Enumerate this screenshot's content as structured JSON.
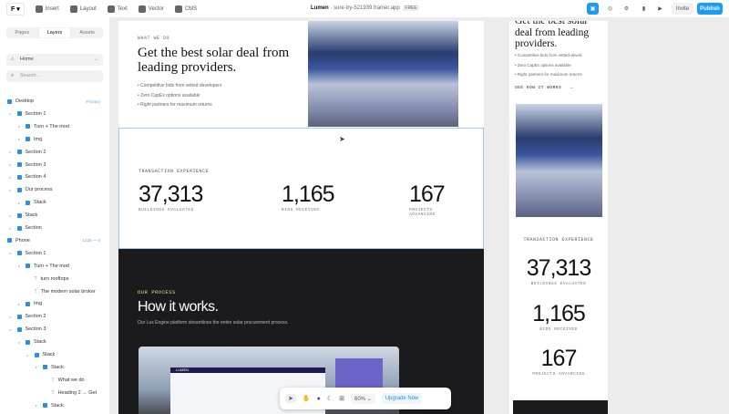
{
  "topbar": {
    "logo": "F",
    "menu": [
      "Insert",
      "Layout",
      "Text",
      "Vector",
      "CMS"
    ],
    "project": "Lumen",
    "domain": "sure-try-521939.framer.app",
    "plan": "FREE",
    "invite": "Invite",
    "publish": "Publish"
  },
  "left": {
    "tabs": [
      "Pages",
      "Layers",
      "Assets"
    ],
    "page": "Home",
    "search_placeholder": "Search...",
    "layers": [
      {
        "label": "Desktop",
        "tag": "Primary"
      },
      {
        "label": "Section 1"
      },
      {
        "label": "Turn + The mod"
      },
      {
        "label": "Img"
      },
      {
        "label": "Section 2"
      },
      {
        "label": "Section 3"
      },
      {
        "label": "Section 4"
      },
      {
        "label": "Our process"
      },
      {
        "label": "Stack"
      },
      {
        "label": "Stack"
      },
      {
        "label": "Section"
      },
      {
        "label": "Phone",
        "tag": "1428 — 0"
      },
      {
        "label": "Section 1"
      },
      {
        "label": "Turn + The mod"
      },
      {
        "label": "turn rooftops"
      },
      {
        "label": "The modern solar broker"
      },
      {
        "label": "Img"
      },
      {
        "label": "Section 2"
      },
      {
        "label": "Section 3"
      },
      {
        "label": "Stack"
      },
      {
        "label": "Stack"
      },
      {
        "label": "Stack"
      },
      {
        "label": "What we do"
      },
      {
        "label": "Heading 2 → Get"
      },
      {
        "label": "Stack"
      }
    ]
  },
  "desktop": {
    "eyebrow": "WHAT WE DO",
    "heading": "Get the best solar deal from leading providers.",
    "bullets": [
      "Competitive bids from vetted developers",
      "Zero CapEx options available",
      "Right partners for maximum returns"
    ],
    "stats_title": "TRANSACTION EXPERIENCE",
    "stats": [
      {
        "value": "37,313",
        "label": "BUILDINGS EVALUATED"
      },
      {
        "value": "1,165",
        "label": "BIDS RECEIVED"
      },
      {
        "value": "167",
        "label": "PROJECTS ADVANCING"
      }
    ],
    "process_eyebrow": "OUR PROCESS",
    "process_heading": "How it works.",
    "process_text": "Our Lux Engine platform streamlines the entire solar procurement process.",
    "mock_logo": "LUMEN"
  },
  "phone": {
    "heading": "Get the best solar deal from leading providers.",
    "bullets": [
      "Competitive bids from vetted develc",
      "Zero CapEx options available",
      "Right partners for maximum returns"
    ],
    "cta": "SEE HOW IT WORKS",
    "cta_arrow": "→"
  },
  "toolbar": {
    "zoom": "60%",
    "upgrade": "Upgrade Now"
  }
}
